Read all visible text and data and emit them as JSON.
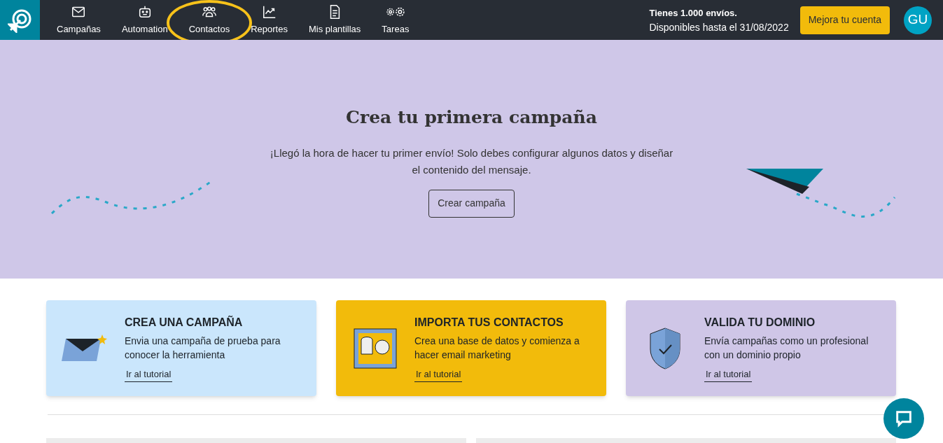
{
  "nav": {
    "items": [
      {
        "label": "Campañas",
        "kind": "mail",
        "highlighted": false
      },
      {
        "label": "Automation",
        "kind": "robot",
        "highlighted": false
      },
      {
        "label": "Contactos",
        "kind": "users",
        "highlighted": true
      },
      {
        "label": "Reportes",
        "kind": "chart",
        "highlighted": false
      },
      {
        "label": "Mis plantillas",
        "kind": "file",
        "highlighted": false
      },
      {
        "label": "Tareas",
        "kind": "gears",
        "highlighted": false
      }
    ],
    "plan_title": "Tienes 1.000 envíos.",
    "plan_expiry": "Disponibles hasta el 31/08/2022",
    "upgrade_button": "Mejora tu cuenta",
    "avatar": "GU"
  },
  "hero": {
    "title": "Crea tu primera campaña",
    "text": "¡Llegó la hora de hacer tu primer envío! Solo debes configurar algunos datos y diseñar el contenido del mensaje.",
    "button": "Crear campaña"
  },
  "cards": [
    {
      "kind": "envelope",
      "color": "#cae6fc",
      "title": "CREA UNA CAMPAÑA",
      "text": "Envia una campaña de prueba para conocer la herramienta",
      "link": "Ir al tutorial"
    },
    {
      "kind": "stamp",
      "color": "#f2bb0b",
      "title": "IMPORTA TUS CONTACTOS",
      "text": "Crea una base de datos y comienza a hacer email marketing",
      "link": "Ir al tutorial"
    },
    {
      "kind": "shield",
      "color": "#cfc6e7",
      "title": "VALIDA TU DOMINIO",
      "text": "Envía campañas como un profesional con un dominio propio",
      "link": "Ir al tutorial"
    }
  ]
}
